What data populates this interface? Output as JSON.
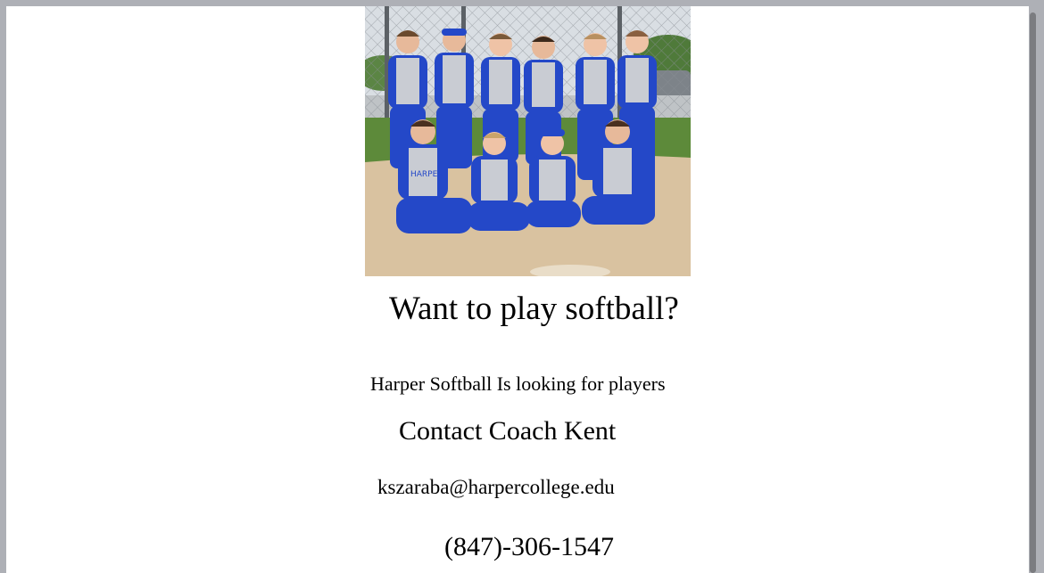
{
  "photo": {
    "description_icon": "team-photo",
    "jersey_text": "HARPER"
  },
  "content": {
    "headline": "Want to play softball?",
    "subheading": "Harper Softball Is looking for players",
    "contact": "Contact Coach Kent",
    "email": "kszaraba@harpercollege.edu",
    "phone": "(847)-306-1547"
  },
  "colors": {
    "frame": "#aeb0b6",
    "page": "#ffffff",
    "scrollbar": "#7b7c80",
    "uniform_blue": "#2448c8",
    "jersey_gray": "#c9ccd3",
    "dirt": "#d9c2a0",
    "grass": "#5d8a3a"
  }
}
